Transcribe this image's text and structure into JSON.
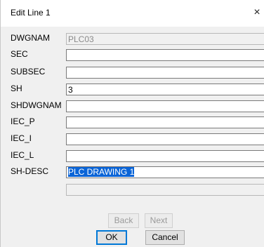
{
  "dialog": {
    "title": "Edit Line 1",
    "close_glyph": "×"
  },
  "fields": [
    {
      "label": "DWGNAM",
      "value": "PLC03",
      "disabled": true
    },
    {
      "label": "SEC",
      "value": ""
    },
    {
      "label": "SUBSEC",
      "value": ""
    },
    {
      "label": "SH",
      "value": "3"
    },
    {
      "label": "SHDWGNAM",
      "value": ""
    },
    {
      "label": "IEC_P",
      "value": ""
    },
    {
      "label": "IEC_I",
      "value": ""
    },
    {
      "label": "IEC_L",
      "value": ""
    },
    {
      "label": "SH-DESC",
      "value": "PLC DRAWING 1",
      "selected": true
    },
    {
      "label": "",
      "value": "",
      "disabled": true
    }
  ],
  "buttons": {
    "back": "Back",
    "next": "Next",
    "ok": "OK",
    "cancel": "Cancel"
  },
  "colors": {
    "selection": "#0a64d7",
    "focus_border": "#0078d7"
  }
}
